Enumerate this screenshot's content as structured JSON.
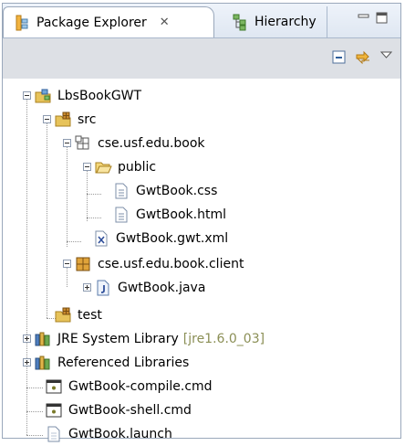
{
  "tabs": {
    "active_label": "Package Explorer",
    "close_glyph": "✕",
    "inactive_label": "Hierarchy"
  },
  "tree": {
    "project": "LbsBookGWT",
    "src": "src",
    "pkg_book": "cse.usf.edu.book",
    "public": "public",
    "css": "GwtBook.css",
    "html": "GwtBook.html",
    "gwt_xml": "GwtBook.gwt.xml",
    "pkg_client": "cse.usf.edu.book.client",
    "java": "GwtBook.java",
    "test": "test",
    "jre": "JRE System Library",
    "jre_version": "[jre1.6.0_03]",
    "ref_libs": "Referenced Libraries",
    "compile_cmd": "GwtBook-compile.cmd",
    "shell_cmd": "GwtBook-shell.cmd",
    "launch": "GwtBook.launch"
  },
  "colors": {
    "tab_bar": "#dfe7f2",
    "toolbar": "#dde0e5",
    "folder": "#e7c35a",
    "package": "#c98a2c",
    "jre_decor": "#8b8f56"
  }
}
